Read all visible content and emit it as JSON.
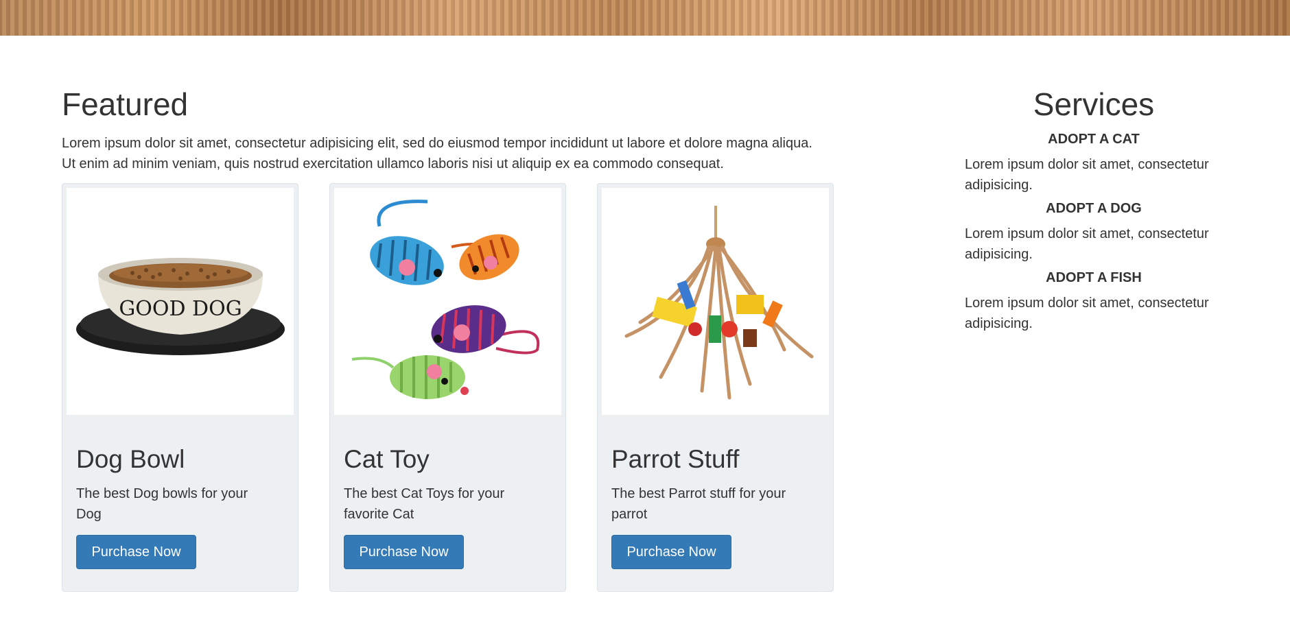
{
  "featured": {
    "title": "Featured",
    "description": "Lorem ipsum dolor sit amet, consectetur adipisicing elit, sed do eiusmod tempor incididunt ut labore et dolore magna aliqua. Ut enim ad minim veniam, quis nostrud exercitation ullamco laboris nisi ut aliquip ex ea commodo consequat."
  },
  "products": [
    {
      "title": "Dog Bowl",
      "text": "The best Dog bowls for your Dog",
      "button": "Purchase Now",
      "image_label": "GOOD DOG"
    },
    {
      "title": "Cat Toy",
      "text": "The best Cat Toys for your favorite Cat",
      "button": "Purchase Now"
    },
    {
      "title": "Parrot Stuff",
      "text": "The best Parrot stuff for your parrot",
      "button": "Purchase Now"
    }
  ],
  "services": {
    "title": "Services",
    "items": [
      {
        "heading": "ADOPT A CAT",
        "text": "Lorem ipsum dolor sit amet, consectetur adipisicing."
      },
      {
        "heading": "ADOPT A DOG",
        "text": "Lorem ipsum dolor sit amet, consectetur adipisicing."
      },
      {
        "heading": "ADOPT A FISH",
        "text": "Lorem ipsum dolor sit amet, consectetur adipisicing."
      }
    ]
  },
  "colors": {
    "button": "#337ab7",
    "card_bg": "#edf0f3",
    "text": "#333333"
  }
}
